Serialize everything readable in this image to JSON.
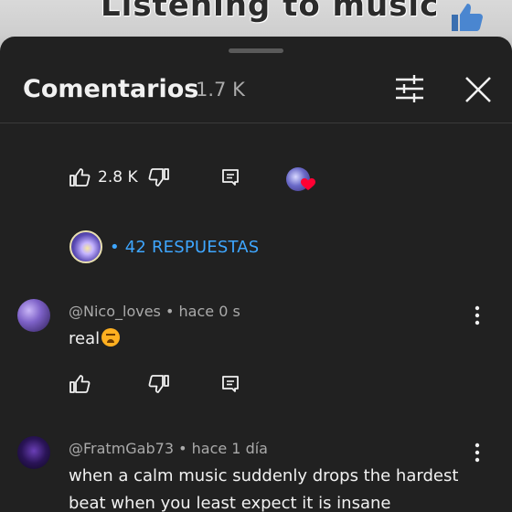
{
  "video": {
    "title": "Listening to music"
  },
  "header": {
    "title": "Comentarios",
    "count": "1.7 K"
  },
  "parent_comment": {
    "like_count": "2.8 K"
  },
  "replies": {
    "label": "• 42 RESPUESTAS"
  },
  "comments": [
    {
      "author": "@Nico_loves",
      "time": "hace 0 s",
      "text": "real"
    },
    {
      "author": "@FratmGab73",
      "time": "hace 1 día",
      "text": "when a calm music suddenly drops the hardest beat when you least expect it is insane"
    }
  ],
  "colors": {
    "accent": "#3ea6ff",
    "heart": "#ff0033",
    "sheet_bg": "#212121"
  }
}
